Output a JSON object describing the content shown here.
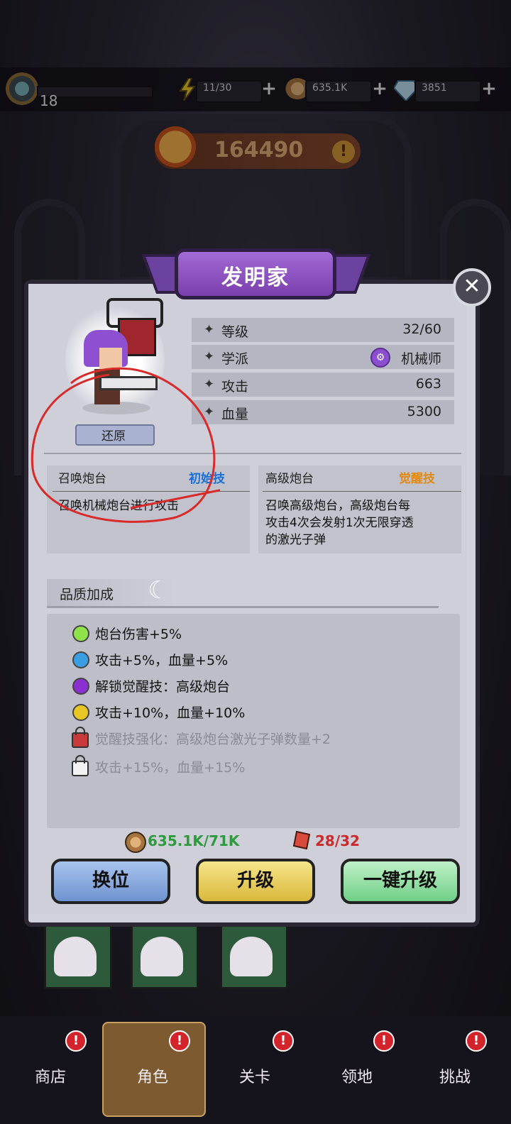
{
  "topbar": {
    "level": "18",
    "xp_fraction": 0.0,
    "energy": "11/30",
    "coins": "635.1K",
    "gems": "3851",
    "plus": "+"
  },
  "power": {
    "value": "164490",
    "warn": "!"
  },
  "modal": {
    "title": "发明家",
    "close": "✕",
    "restore_label": "还原",
    "stats": [
      {
        "label": "等级",
        "value": "32/60"
      },
      {
        "label": "学派",
        "value": "机械师",
        "icon": "gear-icon"
      },
      {
        "label": "攻击",
        "value": "663"
      },
      {
        "label": "血量",
        "value": "5300"
      }
    ],
    "star": "✦",
    "skills": [
      {
        "name": "召唤炮台",
        "tag": "初始技",
        "desc": "召唤机械炮台进行攻击"
      },
      {
        "name": "高级炮台",
        "tag": "觉醒技",
        "desc_lines": [
          "召唤高级炮台，高级炮台每",
          "攻击4次会发射1次无限穿透",
          "的激光子弹"
        ]
      }
    ],
    "quality_title": "品质加成",
    "quality_items": [
      {
        "text": "炮台伤害+5%",
        "color": "#8fe24a",
        "locked": false
      },
      {
        "text": "攻击+5%，血量+5%",
        "color": "#3c9ee2",
        "locked": false
      },
      {
        "text": "解锁觉醒技：高级炮台",
        "color": "#8a2fd0",
        "locked": false
      },
      {
        "text": "攻击+10%，血量+10%",
        "color": "#e8c624",
        "locked": false
      },
      {
        "text": "觉醒技强化：高级炮台激光子弹数量+2",
        "locked": true,
        "lock_color": "#c83a3a"
      },
      {
        "text": "攻击+15%，血量+15%",
        "locked": true,
        "lock_color": "#f2f2f2"
      }
    ],
    "cost_coins": "635.1K/71K",
    "cost_shards": "28/32",
    "buttons": {
      "swap": "换位",
      "upgrade": "升级",
      "one_key": "一键升级"
    }
  },
  "nav": [
    {
      "label": "商店",
      "badge": "!"
    },
    {
      "label": "角色",
      "badge": "!"
    },
    {
      "label": "关卡",
      "badge": "!"
    },
    {
      "label": "领地",
      "badge": "!"
    },
    {
      "label": "挑战",
      "badge": "!"
    }
  ],
  "colors": {
    "accent_purple": "#8b4ed0",
    "green_cost": "#2f9a3d",
    "red_cost": "#cc2a2a",
    "skill_tag_blue": "#1a6fd6",
    "skill_tag_orange": "#e08a12"
  }
}
